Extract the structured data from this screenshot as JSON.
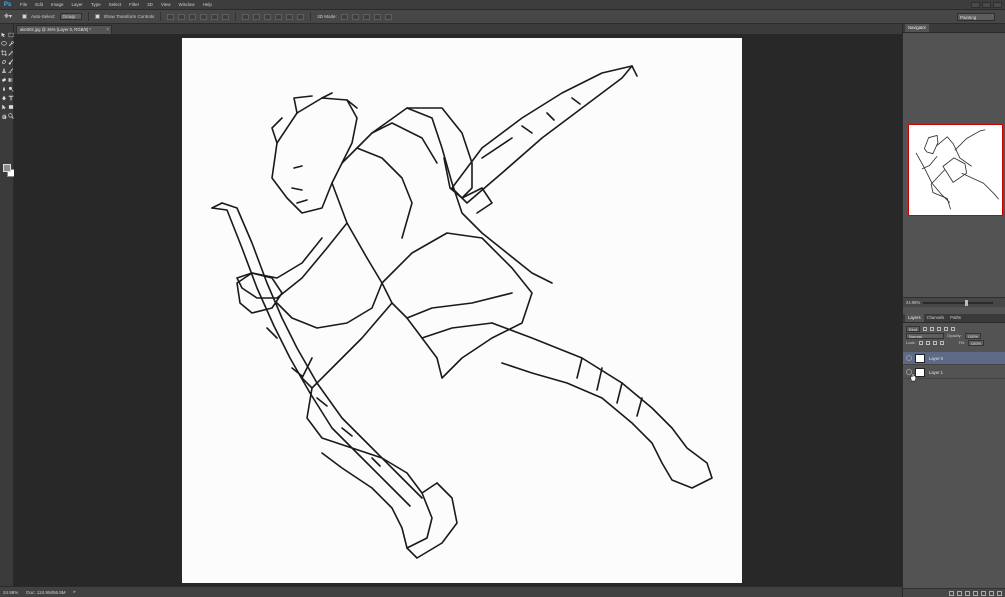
{
  "app": {
    "logo": "Ps"
  },
  "menu": {
    "items": [
      "File",
      "Edit",
      "Image",
      "Layer",
      "Type",
      "Select",
      "Filter",
      "3D",
      "View",
      "Window",
      "Help"
    ]
  },
  "options": {
    "auto_select_label": "Auto-Select:",
    "auto_select_value": "Group",
    "show_transform_label": "Show Transform Controls",
    "mode_3d_label": "3D Mode:",
    "workspace_value": "Painting"
  },
  "document": {
    "tab_title": "ake002.jpg @ 25% (Layer 0, RGB/8) *"
  },
  "status": {
    "zoom": "24.98%",
    "doc_size": "Doc: 124.9M/56.9M"
  },
  "navigator": {
    "tab_label": "Navigator",
    "zoom_label": "24.98%",
    "zoom_fraction": 0.6
  },
  "layers_panel": {
    "tabs": [
      "Layers",
      "Channels",
      "Paths"
    ],
    "kind_label": "Kind",
    "blend_mode": "Normal",
    "opacity_label": "Opacity:",
    "opacity_value": "100%",
    "lock_label": "Lock:",
    "fill_label": "Fill:",
    "fill_value": "100%",
    "layers": [
      {
        "name": "Layer 0",
        "selected": true
      },
      {
        "name": "Layer 1",
        "selected": false
      }
    ]
  },
  "colors": {
    "foreground": "#8c8c8c",
    "background": "#ffffff",
    "selection": "#5d6a85",
    "workspace_bg": "#282828"
  },
  "icons": {
    "tools": [
      "move-icon",
      "marquee-icon",
      "lasso-icon",
      "quick-select-icon",
      "crop-icon",
      "eyedropper-icon",
      "healing-icon",
      "brush-icon",
      "clone-stamp-icon",
      "history-brush-icon",
      "eraser-icon",
      "gradient-icon",
      "blur-icon",
      "dodge-icon",
      "pen-icon",
      "type-icon",
      "path-select-icon",
      "shape-icon",
      "hand-icon",
      "zoom-icon"
    ]
  }
}
